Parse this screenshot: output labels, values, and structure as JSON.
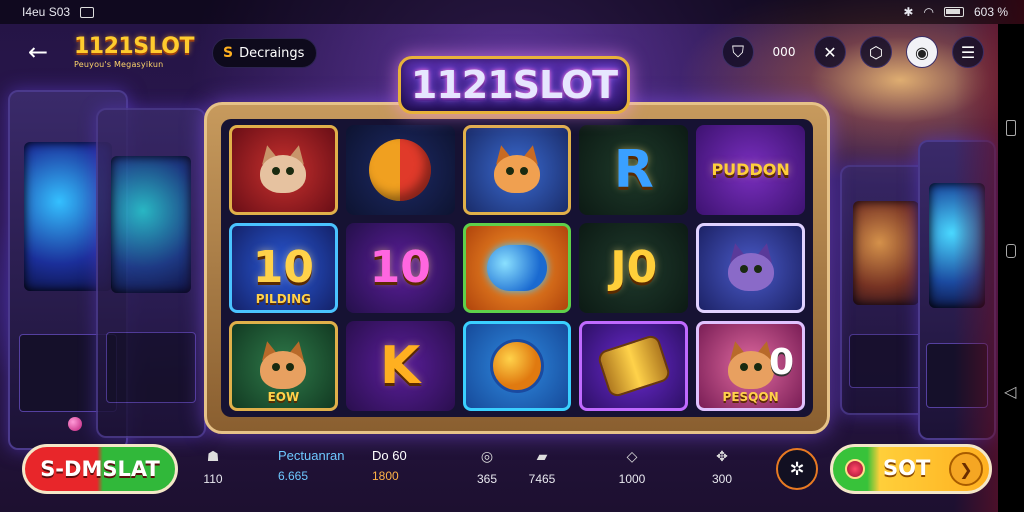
{
  "status_bar": {
    "left_text": "I4eu S03",
    "right_text": "603 %"
  },
  "top_bar": {
    "brand_title": "1121SLOT",
    "brand_subtitle": "Peuyou's Megasyikun",
    "dec_label": "Decraings",
    "dec_icon_glyph": "S",
    "value_text": "000"
  },
  "game_logo": "1121SLOT",
  "reels": [
    {
      "name": "cat-with-bow",
      "style": "c-cat1",
      "framed": true,
      "kind": "cat",
      "fur": "#e6c2a0",
      "ear": "#c8946a"
    },
    {
      "name": "ball",
      "style": "c-ball",
      "framed": false,
      "kind": "ball"
    },
    {
      "name": "cat-scroll",
      "style": "c-cat2",
      "framed": true,
      "kind": "cat",
      "fur": "#f0a050",
      "ear": "#c86a22"
    },
    {
      "name": "letter-r",
      "style": "c-r",
      "framed": false,
      "kind": "text",
      "text": "R",
      "color": "#3aa0ff",
      "size": 52
    },
    {
      "name": "pudding",
      "style": "c-pudding",
      "framed": false,
      "kind": "text",
      "text": "PUDDON",
      "color": "#ffcf3a",
      "size": 16
    },
    {
      "name": "ten-pilding",
      "style": "c-10a",
      "framed": true,
      "kind": "text",
      "text": "10",
      "sub": "PILDING",
      "color": "#ffd24a",
      "size": 44
    },
    {
      "name": "ten-pink",
      "style": "c-10b",
      "framed": false,
      "kind": "text",
      "text": "10",
      "color": "#ff66e0",
      "size": 44
    },
    {
      "name": "blue-orb",
      "style": "c-orb",
      "framed": true,
      "kind": "orb"
    },
    {
      "name": "j-zero",
      "style": "c-j0",
      "framed": false,
      "kind": "text",
      "text": "J0",
      "color": "#ffcf3a",
      "size": 44
    },
    {
      "name": "purple-cat",
      "style": "c-cat3",
      "framed": true,
      "kind": "cat",
      "fur": "#8a6ac8",
      "ear": "#5a3a9a"
    },
    {
      "name": "cat-pot",
      "style": "c-cat4",
      "framed": true,
      "kind": "cat",
      "fur": "#e8a060",
      "ear": "#b86a2a",
      "sub": "EOW"
    },
    {
      "name": "letter-k",
      "style": "c-k",
      "framed": false,
      "kind": "text",
      "text": "K",
      "color": "#ffb020",
      "size": 52
    },
    {
      "name": "rocket",
      "style": "c-rock",
      "framed": true,
      "kind": "rocket"
    },
    {
      "name": "drum",
      "style": "c-drum",
      "framed": true,
      "kind": "drum"
    },
    {
      "name": "pesqon-cat",
      "style": "c-pesq",
      "framed": true,
      "kind": "cat",
      "fur": "#e8a060",
      "ear": "#b86a2a",
      "sub": "PESQON",
      "extra": "0"
    }
  ],
  "bottom_bar": {
    "spin_left_label": "S-DMSLAT",
    "stats": [
      {
        "name": "stat-1",
        "icon": "☗",
        "value": "110"
      },
      {
        "name": "stat-2",
        "label": "Pectuanran",
        "value": "6.665",
        "icon": ""
      },
      {
        "name": "stat-3",
        "label": "Do 60",
        "value": "1800"
      },
      {
        "name": "stat-4",
        "icon": "◎",
        "value": "365"
      },
      {
        "name": "stat-5",
        "icon": "▰",
        "value": "7465"
      },
      {
        "name": "stat-6",
        "icon": "◇",
        "value": "1000"
      },
      {
        "name": "stat-7",
        "icon": "✥",
        "value": "300"
      }
    ],
    "spin_right_label": "SOT",
    "spin_right_arrow": "❯"
  }
}
